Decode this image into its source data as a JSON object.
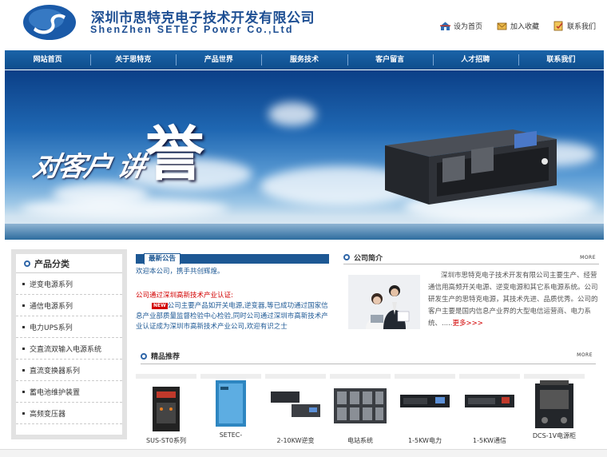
{
  "header": {
    "company_cn": "深圳市思特克电子技术开发有限公司",
    "company_en": "ShenZhen SETEC Power Co.,Ltd",
    "links": [
      {
        "label": "设为首页",
        "icon": "home-icon"
      },
      {
        "label": "加入收藏",
        "icon": "favorite-icon"
      },
      {
        "label": "联系我们",
        "icon": "contact-icon"
      }
    ]
  },
  "nav": [
    "网站首页",
    "关于思特克",
    "产品世界",
    "服务技术",
    "客户留言",
    "人才招聘",
    "联系我们"
  ],
  "banner": {
    "slogan_small": "对客户 讲",
    "slogan_big": "誉"
  },
  "sidebar": {
    "title": "产品分类",
    "items": [
      "逆变电源系列",
      "通信电源系列",
      "电力UPS系列",
      "交直流双输入电源系统",
      "直流变换器系列",
      "蓄电池维护装置",
      "高频变压器"
    ]
  },
  "notice": {
    "tag": "最新公告",
    "welcome": "欢迎本公司，携手共创辉煌。",
    "title": "公司通过深圳高新技术产业认证:",
    "new_badge": "NEW",
    "body": "公司主要产品如开关电源,逆变器,等已成功通过国家信息产业部质量监督检验中心检验,同时公司通过深圳市高新技术产业认证成为深圳市高新技术产业公司,欢迎有识之士"
  },
  "intro": {
    "title": "公司简介",
    "more": "MORE",
    "text": "深圳市思特克电子技术开发有限公司主要生产、经营通信用高频开关电源、逆变电源和其它系电源系统。公司研发生产的思特克电源，其技术先进、品质优秀。公司的客户主要是国内信息产业界的大型电信运营商、电力系统、.....",
    "more_link": "更多>>>"
  },
  "products": {
    "title": "精品推荐",
    "more": "MORE",
    "items": [
      "SUS-ST0系列",
      "SETEC-",
      "2-10KW逆变",
      "电站系统",
      "1-5KW电力",
      "1-5KW通信",
      "DCS-1V电源柜"
    ]
  }
}
